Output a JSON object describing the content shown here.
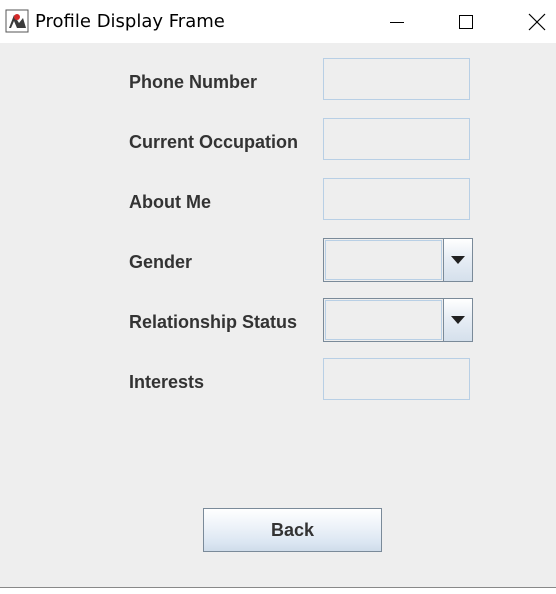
{
  "window": {
    "title": "Profile Display Frame",
    "icon": "java-duke-icon"
  },
  "form": {
    "fields": [
      {
        "label": "Phone Number",
        "type": "text",
        "value": ""
      },
      {
        "label": "Current Occupation",
        "type": "text",
        "value": ""
      },
      {
        "label": "About Me",
        "type": "text",
        "value": ""
      },
      {
        "label": "Gender",
        "type": "combo",
        "value": ""
      },
      {
        "label": "Relationship Status",
        "type": "combo",
        "value": ""
      },
      {
        "label": "Interests",
        "type": "text",
        "value": ""
      }
    ]
  },
  "actions": {
    "back_label": "Back"
  },
  "colors": {
    "background": "#eeeeee",
    "field_border": "#b8cfe5",
    "label_text": "#333333"
  }
}
